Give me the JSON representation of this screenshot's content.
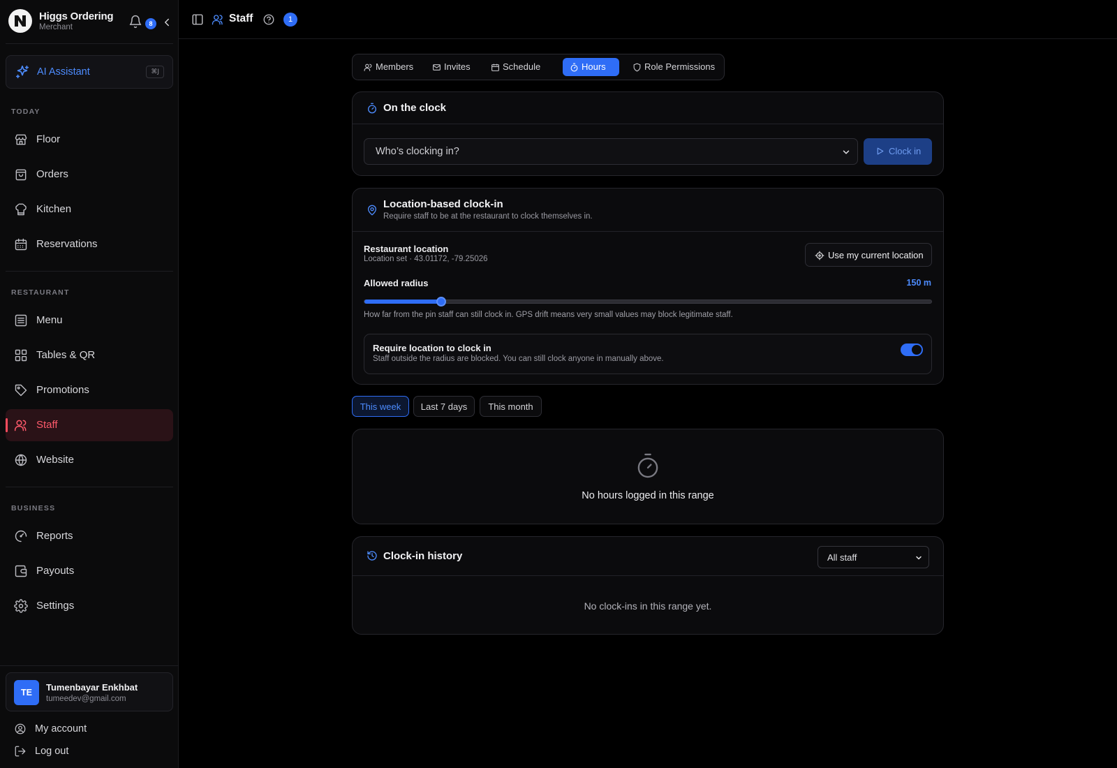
{
  "brand": {
    "name": "Higgs Ordering",
    "subtitle": "Merchant",
    "notifications": "8"
  },
  "ai": {
    "label": "AI Assistant",
    "shortcut": "⌘J"
  },
  "sidebar": {
    "sections": [
      {
        "label": "TODAY",
        "items": [
          {
            "label": "Floor",
            "icon": "store-icon"
          },
          {
            "label": "Orders",
            "icon": "bag-icon"
          },
          {
            "label": "Kitchen",
            "icon": "chef-hat-icon"
          },
          {
            "label": "Reservations",
            "icon": "calendar-icon"
          }
        ]
      },
      {
        "label": "RESTAURANT",
        "items": [
          {
            "label": "Menu",
            "icon": "menu-list-icon"
          },
          {
            "label": "Tables & QR",
            "icon": "grid-icon"
          },
          {
            "label": "Promotions",
            "icon": "tag-icon"
          },
          {
            "label": "Staff",
            "icon": "users-icon",
            "active": true
          },
          {
            "label": "Website",
            "icon": "globe-icon"
          }
        ]
      },
      {
        "label": "BUSINESS",
        "items": [
          {
            "label": "Reports",
            "icon": "gauge-icon"
          },
          {
            "label": "Payouts",
            "icon": "wallet-icon"
          },
          {
            "label": "Settings",
            "icon": "gear-icon"
          }
        ]
      }
    ]
  },
  "user": {
    "initials": "TE",
    "name": "Tumenbayar Enkhbat",
    "email": "tumeedev@gmail.com"
  },
  "footer": {
    "account": "My account",
    "logout": "Log out"
  },
  "topbar": {
    "title": "Staff",
    "count": "1"
  },
  "tabs": [
    {
      "label": "Members",
      "icon": "users-icon"
    },
    {
      "label": "Invites",
      "icon": "mail-icon"
    },
    {
      "label": "Schedule",
      "icon": "calendar-icon"
    },
    {
      "label": "Hours",
      "icon": "timer-icon",
      "active": true
    },
    {
      "label": "Role Permissions",
      "icon": "shield-icon"
    }
  ],
  "on_clock": {
    "title": "On the clock",
    "select_value": "Who’s clocking in?",
    "button": "Clock in"
  },
  "location": {
    "title": "Location-based clock-in",
    "subtitle": "Require staff to be at the restaurant to clock themselves in.",
    "restaurant_label": "Restaurant location",
    "restaurant_value": "Location set · 43.01172, -79.25026",
    "use_location": "Use my current location",
    "radius_label": "Allowed radius",
    "radius_value": "150 m",
    "radius_fraction": 0.135,
    "radius_help": "How far from the pin staff can still clock in. GPS drift means very small values may block legitimate staff.",
    "require_title": "Require location to clock in",
    "require_desc": "Staff outside the radius are blocked. You can still clock anyone in manually above.",
    "require_enabled": true
  },
  "ranges": [
    {
      "label": "This week",
      "active": true
    },
    {
      "label": "Last 7 days"
    },
    {
      "label": "This month"
    }
  ],
  "hours_empty": "No hours logged in this range",
  "history": {
    "title": "Clock-in history",
    "filter": "All staff",
    "empty": "No clock-ins in this range yet."
  },
  "colors": {
    "accent": "#2f6df6",
    "active_nav": "#ff5a6b",
    "background": "#000000"
  }
}
